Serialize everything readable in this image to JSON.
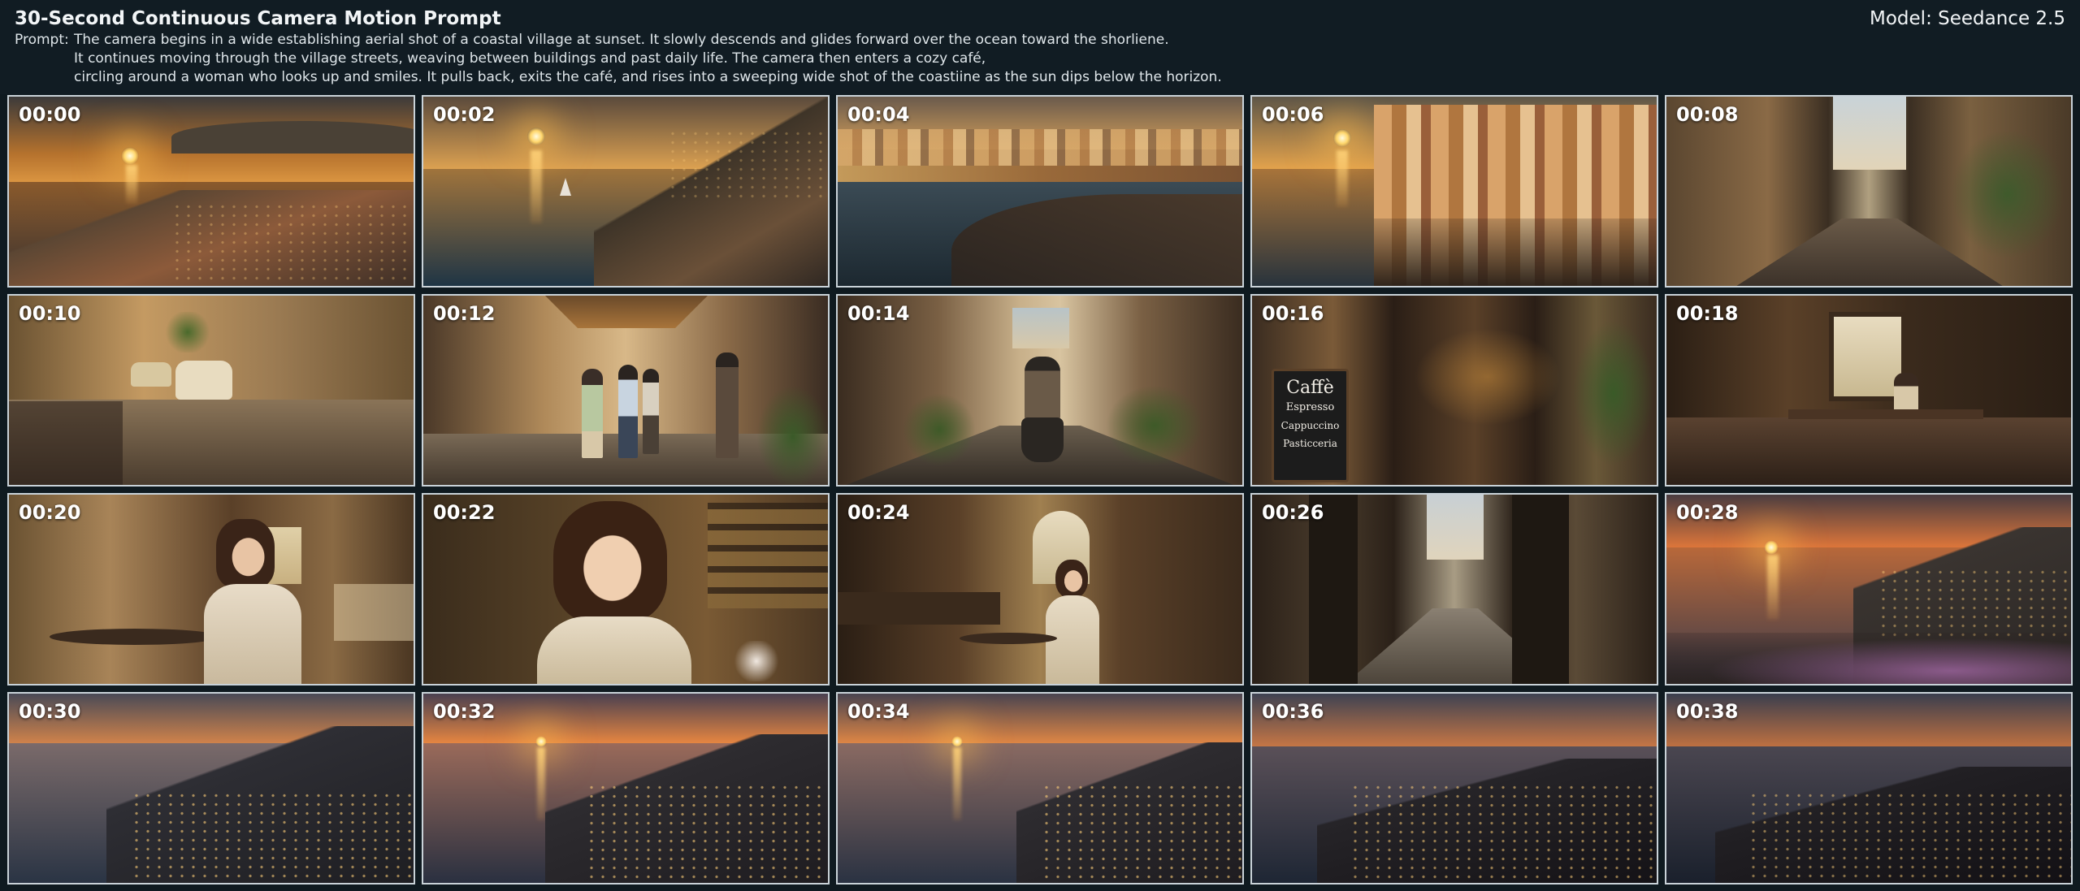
{
  "header": {
    "title": "30-Second Continuous Camera Motion Prompt",
    "model": "Model: Seedance 2.5",
    "prompt_label": "Prompt:",
    "prompt_lines": [
      "The camera begins in a wide establishing aerial shot of a coastal village at sunset. It slowly descends and glides forward over the ocean toward the shorliene.",
      "It continues moving through the village streets, weaving between buildings and past daily life. The camera then enters a cozy café,",
      "circling around a woman who looks up and smiles. It pulls back, exits the café, and rises into a sweeping wide shot of the coastiine as the sun dips below the horizon."
    ]
  },
  "frames": [
    {
      "timestamp": "00:00",
      "scene": "aerial-sunset-village"
    },
    {
      "timestamp": "00:02",
      "scene": "coast-sailboat"
    },
    {
      "timestamp": "00:04",
      "scene": "shoreline-village"
    },
    {
      "timestamp": "00:06",
      "scene": "cliff-houses"
    },
    {
      "timestamp": "00:08",
      "scene": "alley"
    },
    {
      "timestamp": "00:10",
      "scene": "street-car"
    },
    {
      "timestamp": "00:12",
      "scene": "street-people"
    },
    {
      "timestamp": "00:14",
      "scene": "street-scooter"
    },
    {
      "timestamp": "00:16",
      "scene": "cafe-entrance",
      "sign_lines": [
        "Caffè",
        "Espresso",
        "Cappuccino",
        "Pasticceria"
      ]
    },
    {
      "timestamp": "00:18",
      "scene": "cafe-interior"
    },
    {
      "timestamp": "00:20",
      "scene": "woman-cafe"
    },
    {
      "timestamp": "00:22",
      "scene": "woman-closeup"
    },
    {
      "timestamp": "00:24",
      "scene": "woman-wide"
    },
    {
      "timestamp": "00:26",
      "scene": "doorway-exit"
    },
    {
      "timestamp": "00:28",
      "scene": "sunset-coast-flowers"
    },
    {
      "timestamp": "00:30",
      "scene": "dusk-coast"
    },
    {
      "timestamp": "00:32",
      "scene": "dusk-coast"
    },
    {
      "timestamp": "00:34",
      "scene": "dusk-coast"
    },
    {
      "timestamp": "00:36",
      "scene": "night-coast"
    },
    {
      "timestamp": "00:38",
      "scene": "night-coast"
    }
  ]
}
